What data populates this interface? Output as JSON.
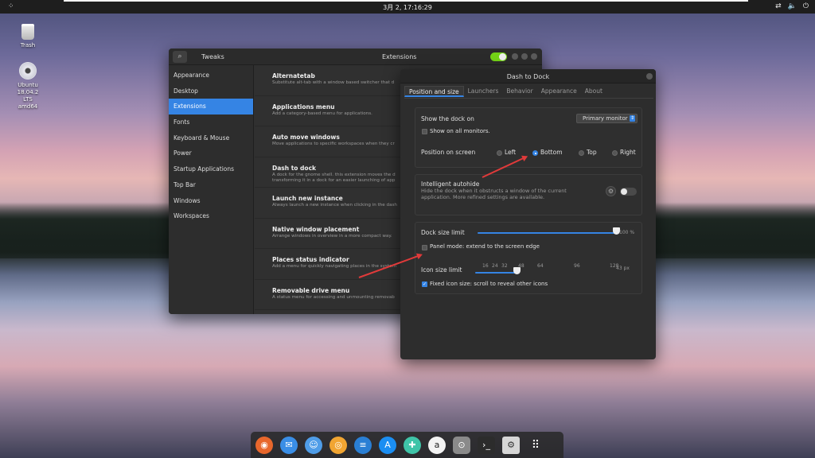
{
  "topbar": {
    "activities_icon": "activities-icon",
    "clock": "3月 2, 17:16:29",
    "tray_icons": [
      "network-icon",
      "volume-icon",
      "power-icon"
    ]
  },
  "desktop": {
    "icons": [
      {
        "label": "Trash",
        "icon": "trash-icon"
      },
      {
        "label": "Ubuntu 18.04.2 LTS amd64",
        "icon": "cd-icon"
      }
    ]
  },
  "tweaks": {
    "title": "Tweaks",
    "panel_title": "Extensions",
    "sidebar": [
      {
        "label": "Appearance"
      },
      {
        "label": "Desktop"
      },
      {
        "label": "Extensions",
        "active": true
      },
      {
        "label": "Fonts"
      },
      {
        "label": "Keyboard & Mouse"
      },
      {
        "label": "Power"
      },
      {
        "label": "Startup Applications"
      },
      {
        "label": "Top Bar"
      },
      {
        "label": "Windows"
      },
      {
        "label": "Workspaces"
      }
    ],
    "extensions": [
      {
        "name": "Alternatetab",
        "desc": "Substitute alt-tab with a window based switcher that d"
      },
      {
        "name": "Applications menu",
        "desc": "Add a category-based menu for applications."
      },
      {
        "name": "Auto move windows",
        "desc": "Move applications to specific workspaces when they cr"
      },
      {
        "name": "Dash to dock",
        "desc": "A dock for the gnome shell. this extension moves the d",
        "desc2": "transforming it in a dock for an easier launching of app"
      },
      {
        "name": "Launch new instance",
        "desc": "Always launch a new instance when clicking in the dash"
      },
      {
        "name": "Native window placement",
        "desc": "Arrange windows in overview in a more compact way."
      },
      {
        "name": "Places status indicator",
        "desc": "Add a menu for quickly navigating places in the system"
      },
      {
        "name": "Removable drive menu",
        "desc": "A status menu for accessing and unmounting removab"
      }
    ]
  },
  "dash": {
    "title": "Dash to Dock",
    "tabs": [
      "Position and size",
      "Launchers",
      "Behavior",
      "Appearance",
      "About"
    ],
    "show_dock_on_label": "Show the dock on",
    "monitor_value": "Primary monitor",
    "show_all_monitors_label": "Show on all monitors.",
    "position_label": "Position on screen",
    "positions": [
      "Left",
      "Bottom",
      "Top",
      "Right"
    ],
    "selected_position": "Bottom",
    "autohide_label": "Intelligent autohide",
    "autohide_desc": "Hide the dock when it obstructs a window of the current application. More refined settings are available.",
    "dock_size_label": "Dock size limit",
    "dock_size_value": "100 %",
    "dock_size_fraction": 1.0,
    "panel_mode_label": "Panel mode: extend to the screen edge",
    "icon_size_label": "Icon size limit",
    "icon_ticks": [
      "16",
      "24",
      "32",
      "48",
      "64",
      "96",
      "128"
    ],
    "icon_size_value": "43 px",
    "fixed_icon_label": "Fixed icon size: scroll to reveal other icons"
  },
  "dock": {
    "items": [
      {
        "icon": "firefox-icon",
        "color": "#e8672c",
        "running": true
      },
      {
        "icon": "thunderbird-icon",
        "color": "#3a8ee6"
      },
      {
        "icon": "finder-icon",
        "color": "#4f9de8"
      },
      {
        "icon": "rhythmbox-icon",
        "color": "#f1a532"
      },
      {
        "icon": "writer-icon",
        "color": "#2a7fd4"
      },
      {
        "icon": "app-store-icon",
        "color": "#1b8ef2"
      },
      {
        "icon": "help-icon",
        "color": "#3fc4a8"
      },
      {
        "icon": "amazon-icon",
        "color": "#f3f3f3"
      },
      {
        "icon": "tweaks-icon",
        "color": "#8a8a8a",
        "running": true
      },
      {
        "icon": "terminal-icon",
        "color": "#2c2c2c"
      },
      {
        "icon": "dash-settings-icon",
        "color": "#d6d6d6",
        "running": true
      },
      {
        "icon": "show-apps-icon",
        "color": "transparent"
      }
    ]
  }
}
